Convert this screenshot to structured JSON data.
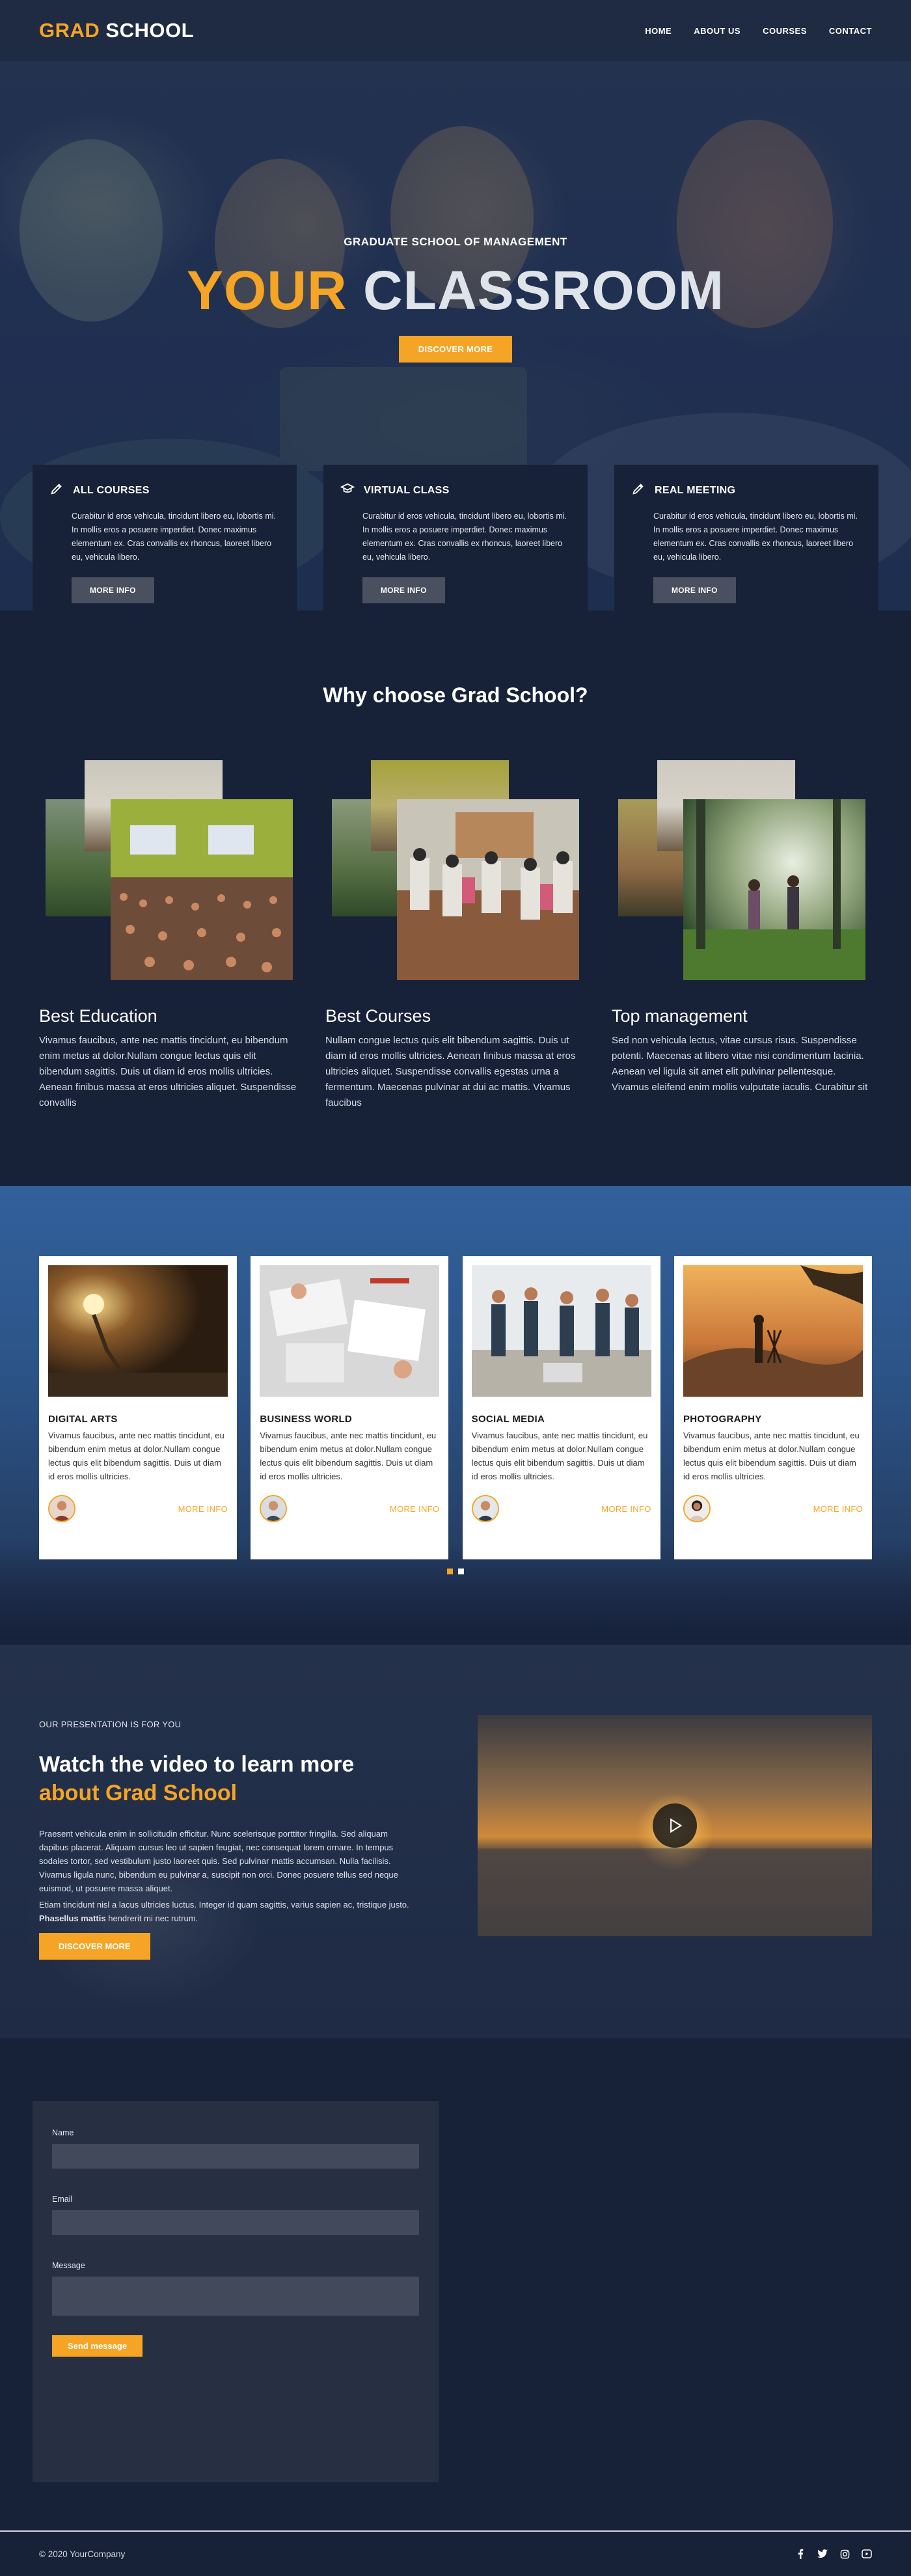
{
  "header": {
    "logo_part1": "GRAD",
    "logo_part2": "SCHOOL",
    "nav": [
      "HOME",
      "ABOUT US",
      "COURSES",
      "CONTACT"
    ]
  },
  "hero": {
    "subtitle": "GRADUATE SCHOOL OF MANAGEMENT",
    "title_part1": "YOUR",
    "title_part2": "CLASSROOM",
    "button": "DISCOVER MORE"
  },
  "features": [
    {
      "icon": "pencil-icon",
      "title": "ALL COURSES",
      "text": "Curabitur id eros vehicula, tincidunt libero eu, lobortis mi. In mollis eros a posuere imperdiet. Donec maximus elementum ex. Cras convallis ex rhoncus, laoreet libero eu, vehicula libero.",
      "button": "MORE INFO"
    },
    {
      "icon": "graduation-cap-icon",
      "title": "VIRTUAL CLASS",
      "text": "Curabitur id eros vehicula, tincidunt libero eu, lobortis mi. In mollis eros a posuere imperdiet. Donec maximus elementum ex. Cras convallis ex rhoncus, laoreet libero eu, vehicula libero.",
      "button": "MORE INFO"
    },
    {
      "icon": "pencil-icon",
      "title": "REAL MEETING",
      "text": "Curabitur id eros vehicula, tincidunt libero eu, lobortis mi. In mollis eros a posuere imperdiet. Donec maximus elementum ex. Cras convallis ex rhoncus, laoreet libero eu, vehicula libero.",
      "button": "MORE INFO"
    }
  ],
  "why": {
    "title": "Why choose Grad School?",
    "items": [
      {
        "title": "Best Education",
        "text": "Vivamus faucibus, ante nec mattis tincidunt, eu bibendum enim metus at dolor.Nullam congue lectus quis elit bibendum sagittis. Duis ut diam id eros mollis ultricies. Aenean finibus massa at eros ultricies aliquet. Suspendisse convallis"
      },
      {
        "title": "Best Courses",
        "text": "Nullam congue lectus quis elit bibendum sagittis. Duis ut diam id eros mollis ultricies. Aenean finibus massa at eros ultricies aliquet. Suspendisse convallis egestas urna a fermentum. Maecenas pulvinar at dui ac mattis. Vivamus faucibus"
      },
      {
        "title": "Top management",
        "text": "Sed non vehicula lectus, vitae cursus risus. Suspendisse potenti. Maecenas at libero vitae nisi condimentum lacinia. Aenean vel ligula sit amet elit pulvinar pellentesque. Vivamus eleifend enim mollis vulputate iaculis. Curabitur sit"
      }
    ]
  },
  "courses": [
    {
      "title": "DIGITAL ARTS",
      "text": "Vivamus faucibus, ante nec mattis tincidunt, eu bibendum enim metus at dolor.Nullam congue lectus quis elit bibendum sagittis. Duis ut diam id eros mollis ultricies.",
      "more": "MORE INFO"
    },
    {
      "title": "BUSINESS WORLD",
      "text": "Vivamus faucibus, ante nec mattis tincidunt, eu bibendum enim metus at dolor.Nullam congue lectus quis elit bibendum sagittis. Duis ut diam id eros mollis ultricies.",
      "more": "MORE INFO"
    },
    {
      "title": "SOCIAL MEDIA",
      "text": "Vivamus faucibus, ante nec mattis tincidunt, eu bibendum enim metus at dolor.Nullam congue lectus quis elit bibendum sagittis. Duis ut diam id eros mollis ultricies.",
      "more": "MORE INFO"
    },
    {
      "title": "PHOTOGRAPHY",
      "text": "Vivamus faucibus, ante nec mattis tincidunt, eu bibendum enim metus at dolor.Nullam congue lectus quis elit bibendum sagittis. Duis ut diam id eros mollis ultricies.",
      "more": "MORE INFO"
    }
  ],
  "video": {
    "small": "OUR PRESENTATION IS FOR YOU",
    "title1": "Watch the video to learn more",
    "title2": "about Grad School",
    "p1": "Praesent vehicula enim in sollicitudin efficitur. Nunc scelerisque porttitor fringilla. Sed aliquam dapibus placerat. Aliquam cursus leo ut sapien feugiat, nec consequat lorem ornare. In tempus sodales tortor, sed vestibulum justo laoreet quis. Sed pulvinar mattis accumsan. Nulla facilisis. Vivamus ligula nunc, bibendum eu pulvinar a, suscipit non orci. Donec posuere tellus sed neque euismod, ut posuere massa aliquet.",
    "p2_before": "Etiam tincidunt nisl a lacus ultricies luctus. Integer id quam sagittis, varius sapien ac, tristique justo. ",
    "p2_bold": "Phasellus mattis",
    "p2_after": " hendrerit mi nec rutrum.",
    "button": "DISCOVER MORE"
  },
  "contact": {
    "name_label": "Name",
    "email_label": "Email",
    "message_label": "Message",
    "button": "Send message"
  },
  "footer": {
    "copyright": "© 2020 YourCompany",
    "social": [
      "facebook-icon",
      "twitter-icon",
      "instagram-icon",
      "youtube-icon"
    ]
  },
  "colors": {
    "accent": "#f5a425",
    "dark": "#172238",
    "header": "#1f2a43"
  }
}
